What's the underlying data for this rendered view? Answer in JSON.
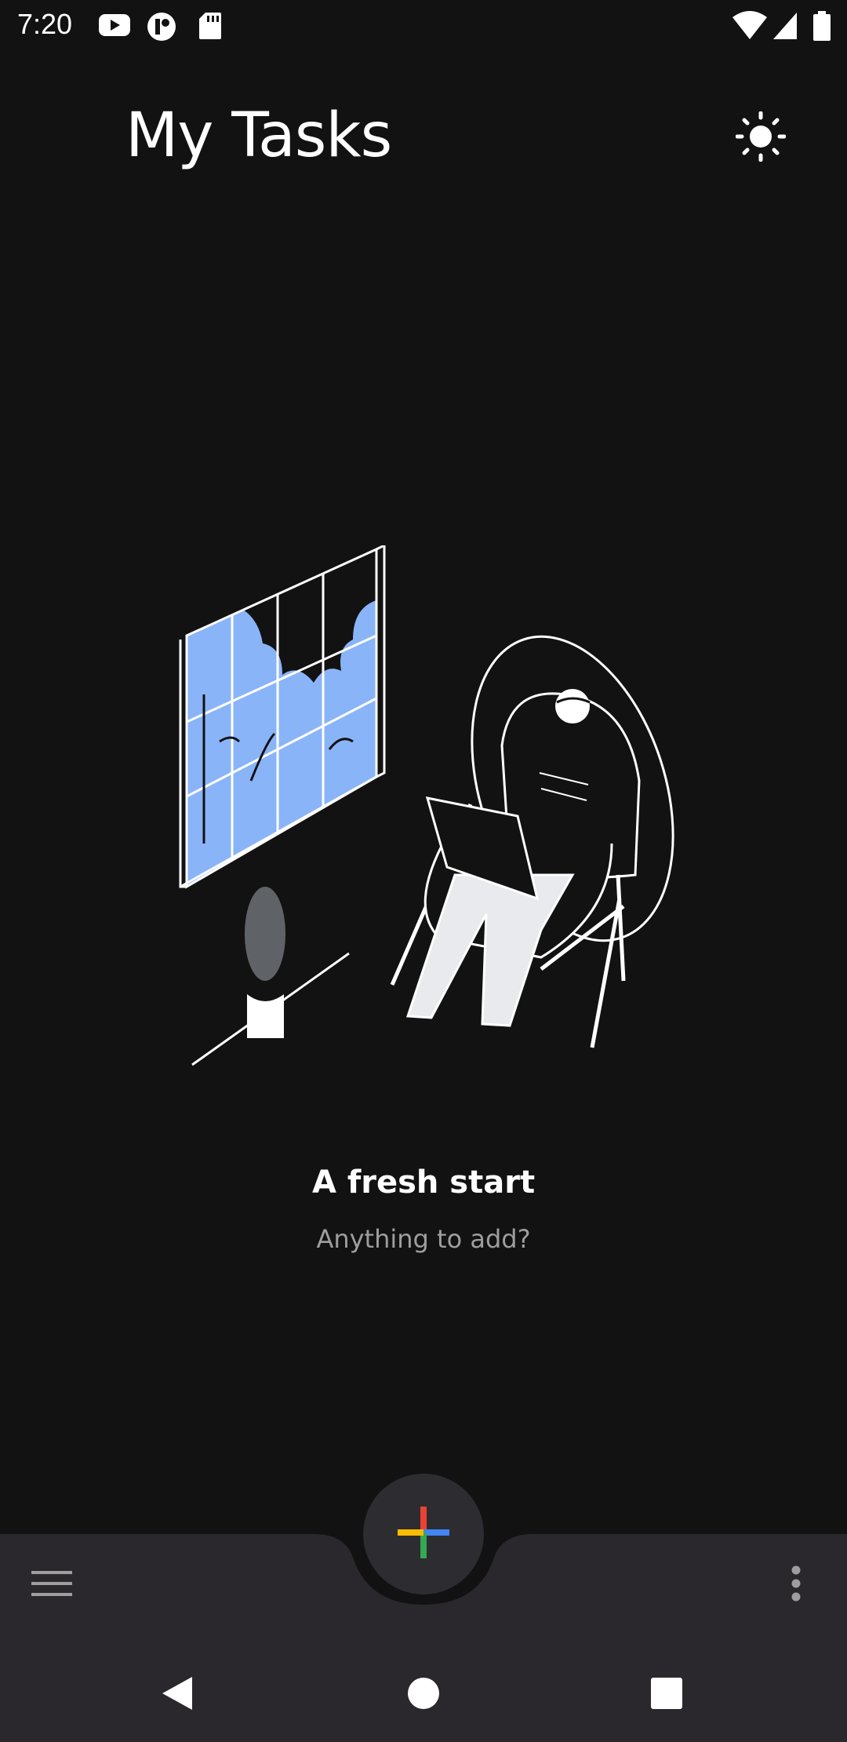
{
  "status_bar": {
    "time": "7:20",
    "left_icons": [
      "youtube-icon",
      "app-notification-icon",
      "sd-card-icon"
    ],
    "right_icons": [
      "wifi-icon",
      "cell-signal-icon",
      "battery-icon"
    ]
  },
  "header": {
    "title": "My Tasks",
    "theme_toggle_icon": "sun-icon"
  },
  "empty_state": {
    "title": "A fresh start",
    "subtitle": "Anything to add?"
  },
  "bottom_bar": {
    "menu_icon": "hamburger-menu-icon",
    "fab_icon": "add-icon",
    "more_icon": "more-vert-icon"
  },
  "nav_bar": {
    "buttons": [
      "back-icon",
      "home-icon",
      "recents-icon"
    ]
  },
  "colors": {
    "background": "#121212",
    "bottom_bar": "#2a282d",
    "fab": "#2d2c30",
    "window_sky": "#8ab4f8",
    "plus_red": "#ea4335",
    "plus_blue": "#4285f4",
    "plus_green": "#34a853",
    "plus_yellow": "#fbbc04"
  }
}
